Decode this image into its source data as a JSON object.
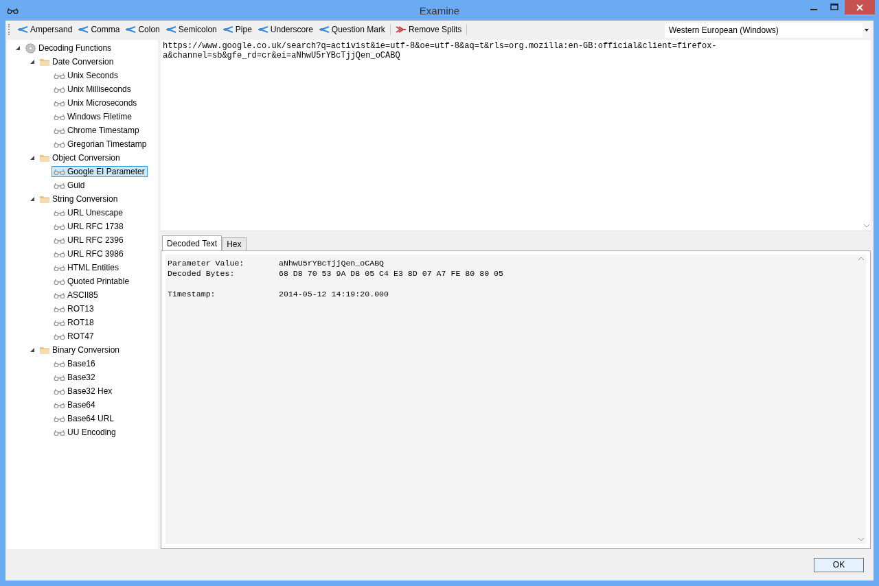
{
  "window": {
    "title": "Examine"
  },
  "toolbar": {
    "buttons": [
      {
        "label": "Ampersand",
        "kind": "split"
      },
      {
        "label": "Comma",
        "kind": "split"
      },
      {
        "label": "Colon",
        "kind": "split"
      },
      {
        "label": "Semicolon",
        "kind": "split"
      },
      {
        "label": "Pipe",
        "kind": "split"
      },
      {
        "label": "Underscore",
        "kind": "split"
      },
      {
        "label": "Question Mark",
        "kind": "split"
      },
      {
        "label": "Remove Splits",
        "kind": "remove"
      }
    ],
    "encoding": {
      "value": "Western European (Windows)"
    }
  },
  "tree": [
    {
      "label": "Decoding Functions",
      "kind": "root",
      "expanded": true,
      "children": [
        {
          "label": "Date Conversion",
          "kind": "folder",
          "expanded": true,
          "children": [
            {
              "label": "Unix Seconds",
              "kind": "function",
              "selected": false
            },
            {
              "label": "Unix Milliseconds",
              "kind": "function",
              "selected": false
            },
            {
              "label": "Unix Microseconds",
              "kind": "function",
              "selected": false
            },
            {
              "label": "Windows Filetime",
              "kind": "function",
              "selected": false
            },
            {
              "label": "Chrome Timestamp",
              "kind": "function",
              "selected": false
            },
            {
              "label": "Gregorian Timestamp",
              "kind": "function",
              "selected": false
            }
          ]
        },
        {
          "label": "Object Conversion",
          "kind": "folder",
          "expanded": true,
          "children": [
            {
              "label": "Google EI Parameter",
              "kind": "function",
              "selected": true
            },
            {
              "label": "Guid",
              "kind": "function",
              "selected": false
            }
          ]
        },
        {
          "label": "String Conversion",
          "kind": "folder",
          "expanded": true,
          "children": [
            {
              "label": "URL Unescape",
              "kind": "function",
              "selected": false
            },
            {
              "label": "URL RFC 1738",
              "kind": "function",
              "selected": false
            },
            {
              "label": "URL RFC 2396",
              "kind": "function",
              "selected": false
            },
            {
              "label": "URL RFC 3986",
              "kind": "function",
              "selected": false
            },
            {
              "label": "HTML Entities",
              "kind": "function",
              "selected": false
            },
            {
              "label": "Quoted Printable",
              "kind": "function",
              "selected": false
            },
            {
              "label": "ASCII85",
              "kind": "function",
              "selected": false
            },
            {
              "label": "ROT13",
              "kind": "function",
              "selected": false
            },
            {
              "label": "ROT18",
              "kind": "function",
              "selected": false
            },
            {
              "label": "ROT47",
              "kind": "function",
              "selected": false
            }
          ]
        },
        {
          "label": "Binary Conversion",
          "kind": "folder",
          "expanded": true,
          "children": [
            {
              "label": "Base16",
              "kind": "function",
              "selected": false
            },
            {
              "label": "Base32",
              "kind": "function",
              "selected": false
            },
            {
              "label": "Base32 Hex",
              "kind": "function",
              "selected": false
            },
            {
              "label": "Base64",
              "kind": "function",
              "selected": false
            },
            {
              "label": "Base64 URL",
              "kind": "function",
              "selected": false
            },
            {
              "label": "UU Encoding",
              "kind": "function",
              "selected": false
            }
          ]
        }
      ]
    }
  ],
  "input": {
    "value": "https://www.google.co.uk/search?q=activist&ie=utf-8&oe=utf-8&aq=t&rls=org.mozilla:en-GB:official&client=firefox-a&channel=sb&gfe_rd=cr&ei=aNhwU5rYBcTjjQen_oCABQ"
  },
  "tabs": [
    {
      "label": "Decoded Text",
      "selected": true
    },
    {
      "label": "Hex",
      "selected": false
    }
  ],
  "output": {
    "rows": [
      {
        "kind": "field",
        "label": "Parameter Value:",
        "value": "aNhwU5rYBcTjjQen_oCABQ"
      },
      {
        "kind": "field",
        "label": "Decoded Bytes:",
        "value": "68 D8 70 53 9A D8 05 C4 E3 8D 07 A7 FE 80 80 05"
      },
      {
        "kind": "blank"
      },
      {
        "kind": "field",
        "label": "Timestamp:",
        "value": "2014-05-12 14:19:20.000"
      }
    ]
  },
  "buttons": [
    {
      "label": "OK"
    }
  ]
}
